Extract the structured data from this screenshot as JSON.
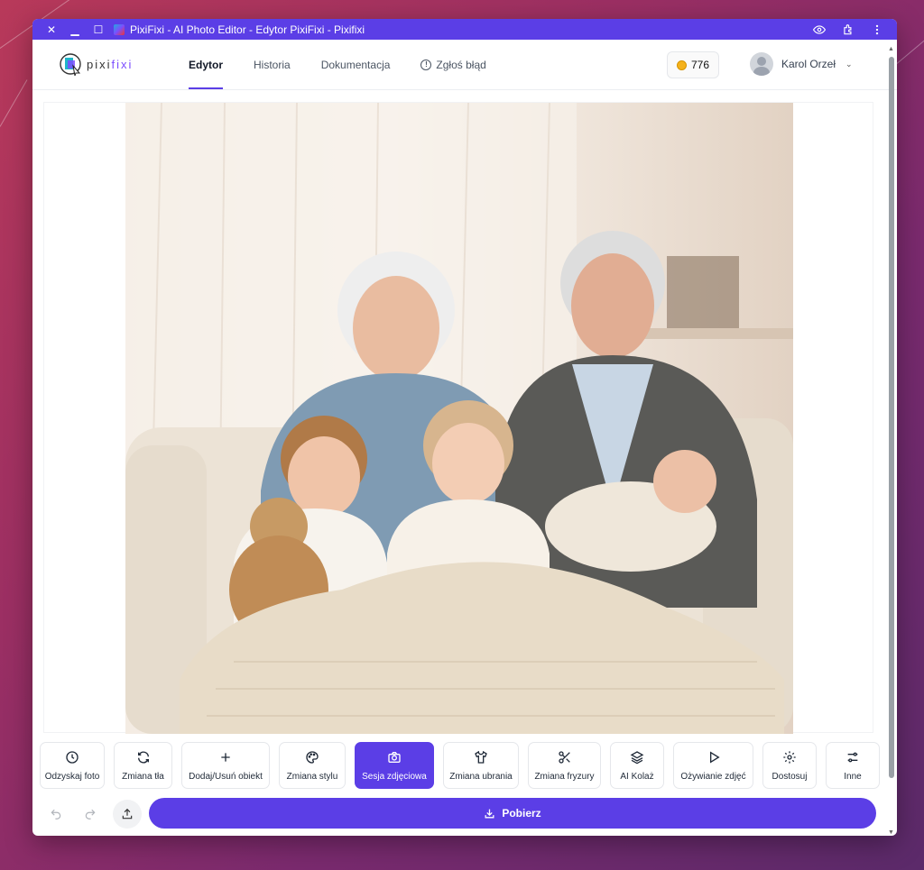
{
  "window": {
    "title": "PixiFixi - AI Photo Editor - Edytor PixiFixi - Pixifixi"
  },
  "header": {
    "logo_text": "pixifixi",
    "nav": [
      {
        "label": "Edytor",
        "active": true
      },
      {
        "label": "Historia",
        "active": false
      },
      {
        "label": "Dokumentacja",
        "active": false
      },
      {
        "label": "Zgłoś błąd",
        "active": false
      }
    ],
    "credits": "776",
    "user_name": "Karol Orzeł"
  },
  "photo": {
    "icon": "family-photo-image"
  },
  "toolbar": {
    "tools": [
      {
        "label": "Odzyskaj foto",
        "icon": "clock-icon"
      },
      {
        "label": "Zmiana tła",
        "icon": "refresh-icon"
      },
      {
        "label": "Dodaj/Usuń obiekt",
        "icon": "plus-icon"
      },
      {
        "label": "Zmiana stylu",
        "icon": "palette-icon"
      },
      {
        "label": "Sesja zdjęciowa",
        "icon": "camera-icon",
        "active": true
      },
      {
        "label": "Zmiana ubrania",
        "icon": "shirt-icon"
      },
      {
        "label": "Zmiana fryzury",
        "icon": "scissors-icon"
      },
      {
        "label": "AI Kolaż",
        "icon": "layers-icon"
      },
      {
        "label": "Ożywianie zdjęć",
        "icon": "play-icon"
      },
      {
        "label": "Dostosuj",
        "icon": "gear-icon"
      },
      {
        "label": "Inne",
        "icon": "sliders-icon"
      }
    ]
  },
  "actions": {
    "download_label": "Pobierz"
  },
  "colors": {
    "accent": "#5b3ee6",
    "coin": "#f5b21b"
  }
}
